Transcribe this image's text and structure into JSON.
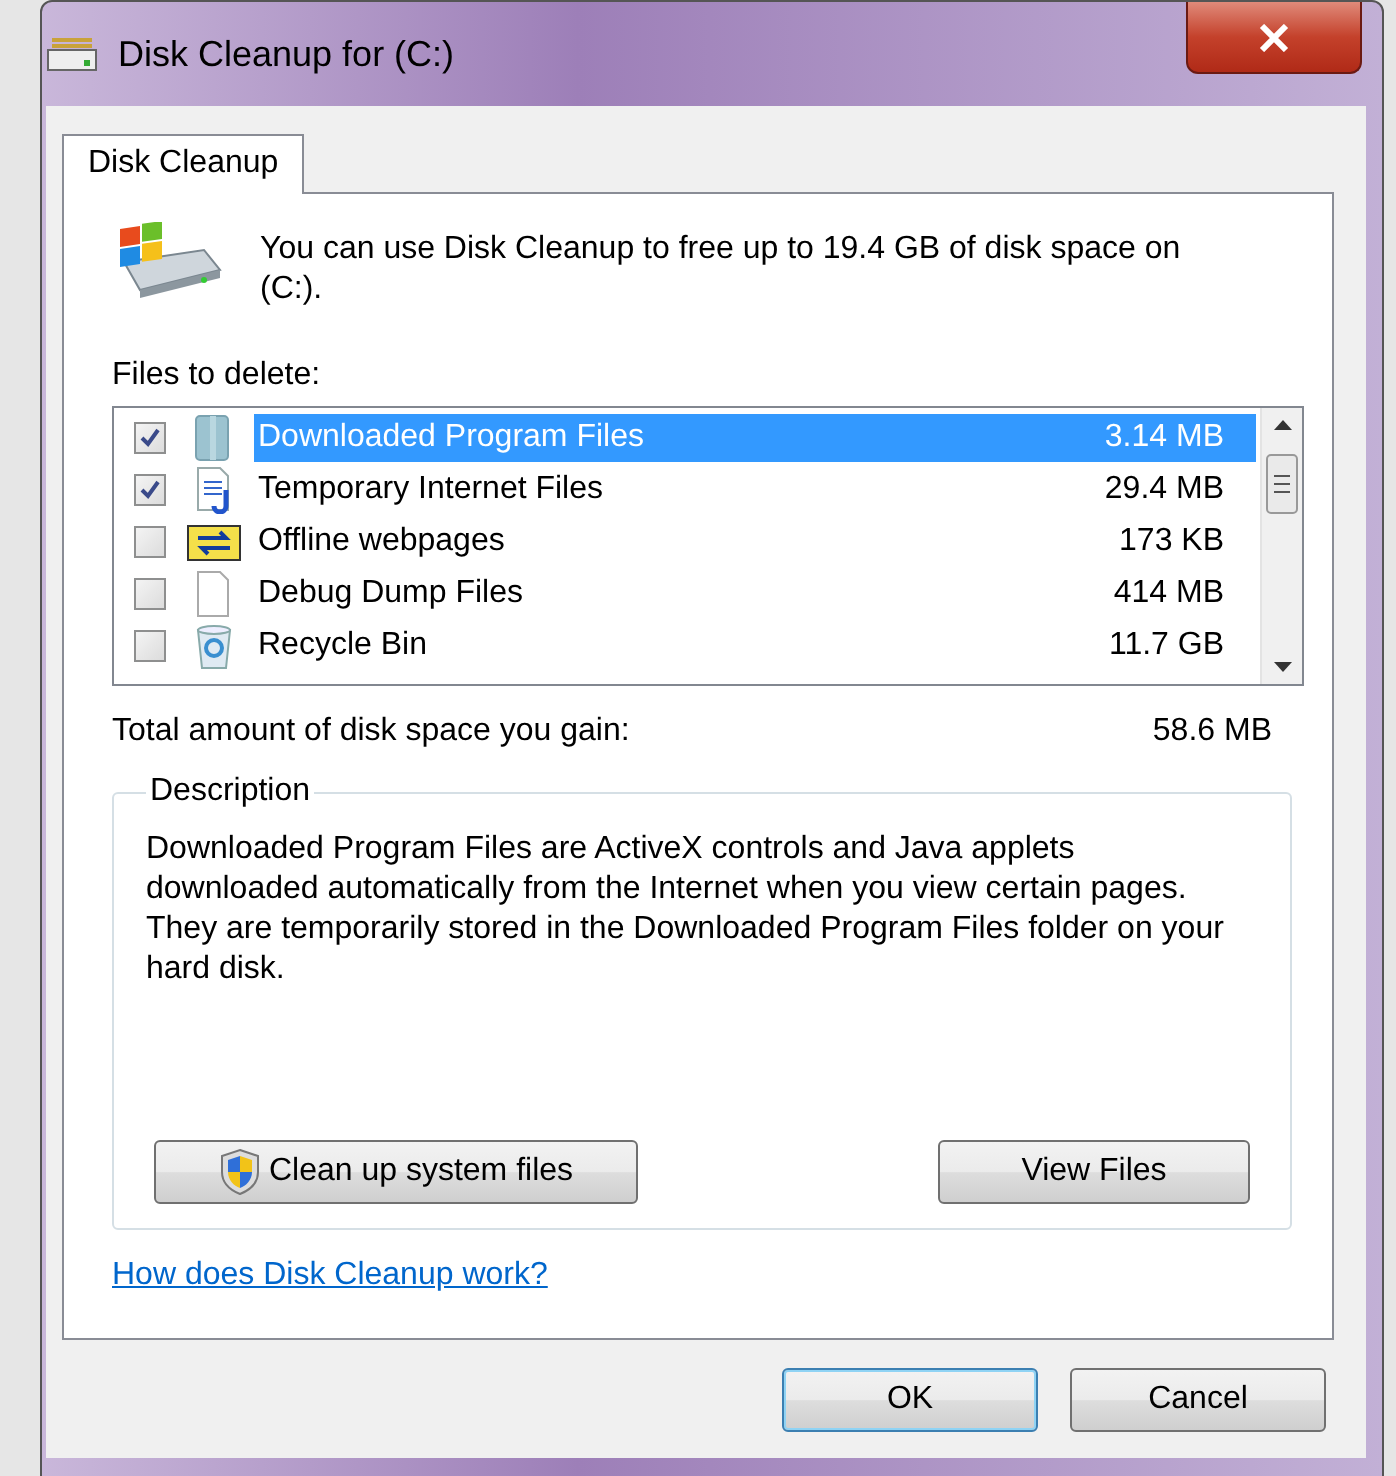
{
  "window": {
    "title": "Disk Cleanup for  (C:)"
  },
  "tabs": [
    {
      "label": "Disk Cleanup",
      "selected": true
    }
  ],
  "intro": "You can use Disk Cleanup to free up to 19.4 GB of disk space on  (C:).",
  "files_label": "Files to delete:",
  "files": [
    {
      "name": "Downloaded Program Files",
      "size": "3.14 MB",
      "checked": true,
      "selected": true
    },
    {
      "name": "Temporary Internet Files",
      "size": "29.4 MB",
      "checked": true,
      "selected": false
    },
    {
      "name": "Offline webpages",
      "size": "173 KB",
      "checked": false,
      "selected": false
    },
    {
      "name": "Debug Dump Files",
      "size": "414 MB",
      "checked": false,
      "selected": false
    },
    {
      "name": "Recycle Bin",
      "size": "11.7 GB",
      "checked": false,
      "selected": false
    }
  ],
  "total": {
    "label": "Total amount of disk space you gain:",
    "value": "58.6 MB"
  },
  "description": {
    "legend": "Description",
    "text": "Downloaded Program Files are ActiveX controls and Java applets downloaded automatically from the Internet when you view certain pages. They are temporarily stored in the Downloaded Program Files folder on your hard disk."
  },
  "buttons": [
    {
      "label": "Clean up system files",
      "kind": "shield"
    },
    {
      "label": "View Files",
      "kind": "plain"
    }
  ],
  "help_link": "How does Disk Cleanup work?",
  "dialog_buttons": [
    {
      "label": "OK",
      "default": true
    },
    {
      "label": "Cancel",
      "default": false
    }
  ]
}
